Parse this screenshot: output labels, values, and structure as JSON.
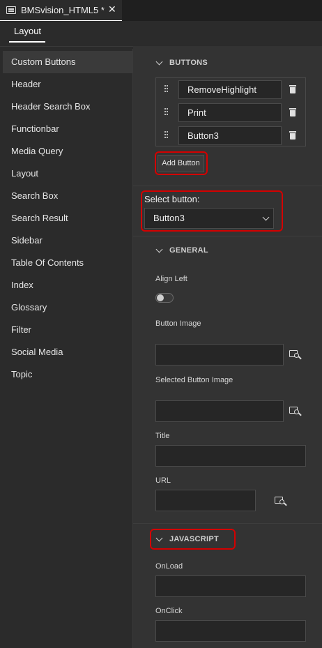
{
  "document_tab": {
    "title": "BMSvision_HTML5 *",
    "close_glyph": "✕",
    "icon": "document-icon"
  },
  "subtabs": [
    {
      "label": "Layout",
      "active": true
    }
  ],
  "sidebar": {
    "items": [
      {
        "label": "Custom Buttons",
        "active": true
      },
      {
        "label": "Header"
      },
      {
        "label": "Header Search Box"
      },
      {
        "label": "Functionbar"
      },
      {
        "label": "Media Query"
      },
      {
        "label": "Layout"
      },
      {
        "label": "Search Box"
      },
      {
        "label": "Search Result"
      },
      {
        "label": "Sidebar"
      },
      {
        "label": "Table Of Contents"
      },
      {
        "label": "Index"
      },
      {
        "label": "Glossary"
      },
      {
        "label": "Filter"
      },
      {
        "label": "Social Media"
      },
      {
        "label": "Topic"
      }
    ]
  },
  "buttons_section": {
    "heading": "BUTTONS",
    "items": [
      {
        "label": "RemoveHighlight"
      },
      {
        "label": "Print"
      },
      {
        "label": "Button3"
      }
    ],
    "add_button_label": "Add Button"
  },
  "select_button": {
    "label": "Select button:",
    "value": "Button3"
  },
  "general_section": {
    "heading": "GENERAL",
    "align_left_label": "Align Left",
    "align_left_on": false,
    "button_image_label": "Button Image",
    "button_image_value": "",
    "selected_button_image_label": "Selected Button Image",
    "selected_button_image_value": "",
    "title_label": "Title",
    "title_value": "",
    "url_label": "URL",
    "url_value": ""
  },
  "javascript_section": {
    "heading": "JAVASCRIPT",
    "onload_label": "OnLoad",
    "onload_value": "",
    "onclick_label": "OnClick",
    "onclick_value": ""
  },
  "colors": {
    "highlight": "#d40000",
    "background": "#2b2b2b",
    "panel": "#333333"
  }
}
